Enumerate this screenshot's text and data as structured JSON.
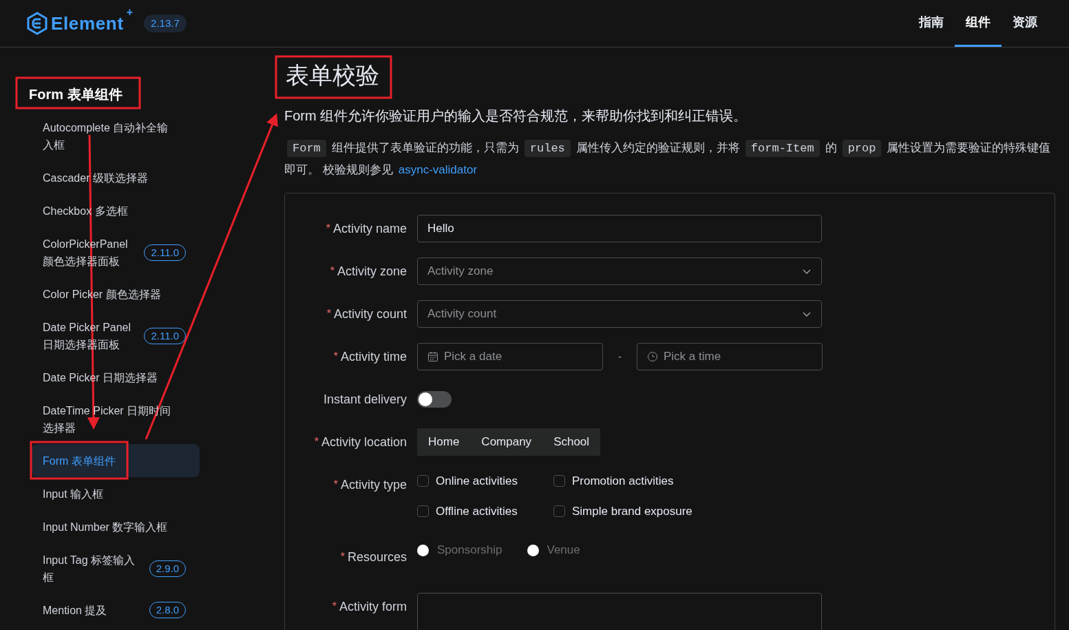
{
  "header": {
    "logo": {
      "text": "Element",
      "sup": "+"
    },
    "version": "2.13.7",
    "nav": [
      {
        "label": "指南",
        "selected": false
      },
      {
        "label": "组件",
        "selected": true
      },
      {
        "label": "资源",
        "selected": false
      }
    ]
  },
  "sidebar": {
    "group": "Form 表单组件",
    "items": [
      {
        "label": "Autocomplete 自动补全输入框",
        "selected": false
      },
      {
        "label": "Cascader 级联选择器",
        "selected": false
      },
      {
        "label": "Checkbox 多选框",
        "selected": false
      },
      {
        "label": "ColorPickerPanel 颜色选择器面板",
        "badge": "2.11.0",
        "selected": false
      },
      {
        "label": "Color Picker 颜色选择器",
        "selected": false
      },
      {
        "label": "Date Picker Panel 日期选择器面板",
        "badge": "2.11.0",
        "selected": false
      },
      {
        "label": "Date Picker 日期选择器",
        "selected": false
      },
      {
        "label": "DateTime Picker 日期时间选择器",
        "selected": false
      },
      {
        "label": "Form 表单组件",
        "selected": true
      },
      {
        "label": "Input 输入框",
        "selected": false
      },
      {
        "label": "Input Number 数字输入框",
        "selected": false
      },
      {
        "label": "Input Tag 标签输入框",
        "badge": "2.9.0",
        "selected": false
      },
      {
        "label": "Mention 提及",
        "badge": "2.8.0",
        "selected": false
      }
    ]
  },
  "content": {
    "title": "表单校验",
    "intro": "Form 组件允许你验证用户的输入是否符合规范，来帮助你找到和纠正错误。",
    "description": [
      {
        "kind": "code",
        "text": "Form"
      },
      {
        "kind": "text",
        "text": "组件提供了表单验证的功能，只需为"
      },
      {
        "kind": "code",
        "text": "rules"
      },
      {
        "kind": "text",
        "text": "属性传入约定的验证规则，并将"
      },
      {
        "kind": "code",
        "text": "form-Item"
      },
      {
        "kind": "text",
        "text": "的"
      },
      {
        "kind": "code",
        "text": "prop"
      },
      {
        "kind": "text",
        "text": "属性设置为需要验证的特殊键值即可。 校验规则参见"
      },
      {
        "kind": "link",
        "text": "async-validator"
      }
    ],
    "form": [
      {
        "kind": "input",
        "label": "Activity name",
        "required_mark": "*",
        "value": "Hello"
      },
      {
        "kind": "select",
        "label": "Activity zone",
        "required_mark": "*",
        "placeholder": "Activity zone"
      },
      {
        "kind": "select",
        "label": "Activity count",
        "required_mark": "*",
        "placeholder": "Activity count"
      },
      {
        "kind": "datetime",
        "label": "Activity time",
        "required_mark": "*",
        "date_placeholder": "Pick a date",
        "separator": "-",
        "time_placeholder": "Pick a time"
      },
      {
        "kind": "switch",
        "label": "Instant delivery",
        "on": false
      },
      {
        "kind": "segmented",
        "label": "Activity location",
        "required_mark": "*",
        "options": [
          {
            "label": "Home",
            "selected": false
          },
          {
            "label": "Company",
            "selected": false
          },
          {
            "label": "School",
            "selected": false
          }
        ]
      },
      {
        "kind": "checkbox",
        "label": "Activity type",
        "required_mark": "*",
        "options": [
          {
            "label": "Online activities",
            "checked": false
          },
          {
            "label": "Promotion activities",
            "checked": false
          },
          {
            "label": "Offline activities",
            "checked": false
          },
          {
            "label": "Simple brand exposure",
            "checked": false
          }
        ]
      },
      {
        "kind": "radio",
        "label": "Resources",
        "required_mark": "*",
        "options": [
          {
            "label": "Sponsorship",
            "selected": false
          },
          {
            "label": "Venue",
            "selected": false
          }
        ]
      },
      {
        "kind": "textarea",
        "label": "Activity form",
        "required_mark": "*"
      }
    ]
  }
}
